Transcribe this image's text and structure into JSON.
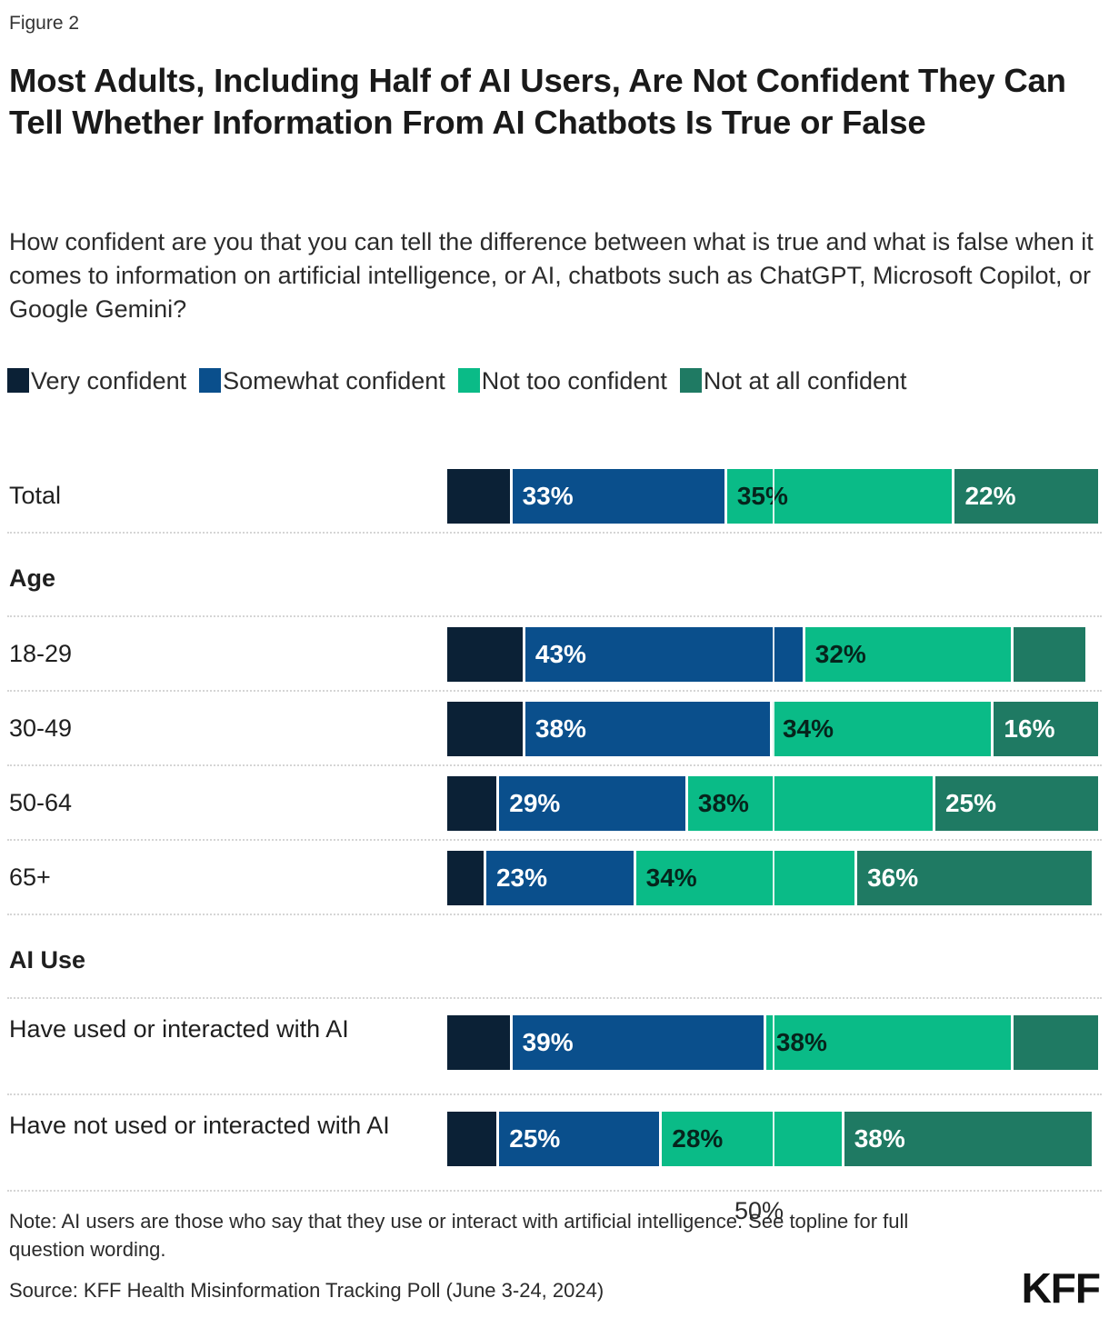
{
  "figure_label": "Figure 2",
  "title": "Most Adults, Including Half of AI Users, Are Not Confident They Can Tell Whether Information From AI Chatbots Is True or False",
  "subtitle": "How confident are you that you can tell the difference between what is true and what is false when it comes to information on artificial intelligence, or AI, chatbots such as ChatGPT, Microsoft Copilot, or Google Gemini?",
  "legend": [
    {
      "label": "Very confident",
      "color": "#0b2136"
    },
    {
      "label": "Somewhat confident",
      "color": "#0a4f8c"
    },
    {
      "label": "Not too confident",
      "color": "#0abb87"
    },
    {
      "label": "Not at all confident",
      "color": "#1f7a63"
    }
  ],
  "axis": {
    "midpoint_label": "50%"
  },
  "note": "Note: AI users are those who say that they use or interact with artificial intelligence. See topline for full question wording.",
  "source": "Source: KFF Health Misinformation Tracking Poll (June 3-24, 2024)",
  "logo": "KFF",
  "chart_data": {
    "type": "bar",
    "subtype": "stacked-horizontal-100",
    "title": "Most Adults, Including Half of AI Users, Are Not Confident They Can Tell Whether Information From AI Chatbots Is True or False",
    "xlabel": "",
    "ylabel": "",
    "xlim": [
      0,
      100
    ],
    "xticks": [
      50
    ],
    "xticklabels": [
      "50%"
    ],
    "grid": false,
    "legend_position": "top",
    "series": [
      {
        "name": "Very confident",
        "color": "#0b2136"
      },
      {
        "name": "Somewhat confident",
        "color": "#0a4f8c"
      },
      {
        "name": "Not too confident",
        "color": "#0abb87"
      },
      {
        "name": "Not at all confident",
        "color": "#1f7a63"
      }
    ],
    "rows": [
      {
        "kind": "bar",
        "category": "Total",
        "values": [
          10,
          33,
          35,
          22
        ],
        "labels": [
          "",
          "33%",
          "35%",
          "22%"
        ]
      },
      {
        "kind": "group",
        "category": "Age"
      },
      {
        "kind": "bar",
        "category": "18-29",
        "values": [
          12,
          43,
          32,
          11
        ],
        "labels": [
          "",
          "43%",
          "32%",
          ""
        ]
      },
      {
        "kind": "bar",
        "category": "30-49",
        "values": [
          12,
          38,
          34,
          16
        ],
        "labels": [
          "",
          "38%",
          "34%",
          "16%"
        ]
      },
      {
        "kind": "bar",
        "category": "50-64",
        "values": [
          8,
          29,
          38,
          25
        ],
        "labels": [
          "",
          "29%",
          "38%",
          "25%"
        ]
      },
      {
        "kind": "bar",
        "category": "65+",
        "values": [
          6,
          23,
          34,
          36
        ],
        "labels": [
          "",
          "23%",
          "34%",
          "36%"
        ]
      },
      {
        "kind": "group",
        "category": "AI Use"
      },
      {
        "kind": "bar",
        "category": "Have used or interacted with AI",
        "values": [
          10,
          39,
          38,
          13
        ],
        "labels": [
          "",
          "39%",
          "38%",
          ""
        ]
      },
      {
        "kind": "bar",
        "category": "Have not used or interacted with AI",
        "values": [
          8,
          25,
          28,
          38
        ],
        "labels": [
          "",
          "25%",
          "28%",
          "38%"
        ]
      }
    ]
  }
}
